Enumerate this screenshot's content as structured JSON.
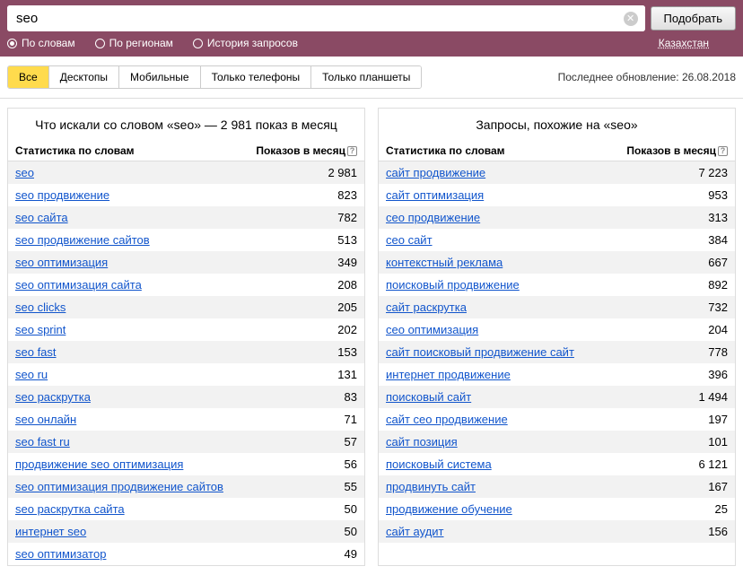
{
  "search": {
    "value": "seo",
    "submit": "Подобрать"
  },
  "filters": {
    "by_words": "По словам",
    "by_regions": "По регионам",
    "history": "История запросов",
    "region": "Казахстан"
  },
  "tabs": {
    "all": "Все",
    "desktops": "Десктопы",
    "mobile": "Мобильные",
    "phones": "Только телефоны",
    "tablets": "Только планшеты"
  },
  "update_text": "Последнее обновление: 26.08.2018",
  "left": {
    "title": "Что искали со словом «seo» — 2 981 показ в месяц",
    "col_word": "Статистика по словам",
    "col_count": "Показов в месяц",
    "rows": [
      {
        "w": "seo",
        "c": "2 981"
      },
      {
        "w": "seo продвижение",
        "c": "823"
      },
      {
        "w": "seo сайта",
        "c": "782"
      },
      {
        "w": "seo продвижение сайтов",
        "c": "513"
      },
      {
        "w": "seo оптимизация",
        "c": "349"
      },
      {
        "w": "seo оптимизация сайта",
        "c": "208"
      },
      {
        "w": "seo clicks",
        "c": "205"
      },
      {
        "w": "seo sprint",
        "c": "202"
      },
      {
        "w": "seo fast",
        "c": "153"
      },
      {
        "w": "seo ru",
        "c": "131"
      },
      {
        "w": "seo раскрутка",
        "c": "83"
      },
      {
        "w": "seo онлайн",
        "c": "71"
      },
      {
        "w": "seo fast ru",
        "c": "57"
      },
      {
        "w": "продвижение seo оптимизация",
        "c": "56"
      },
      {
        "w": "seo оптимизация продвижение сайтов",
        "c": "55"
      },
      {
        "w": "seo раскрутка сайта",
        "c": "50"
      },
      {
        "w": "интернет seo",
        "c": "50"
      },
      {
        "w": "seo оптимизатор",
        "c": "49"
      }
    ]
  },
  "right": {
    "title": "Запросы, похожие на «seo»",
    "col_word": "Статистика по словам",
    "col_count": "Показов в месяц",
    "rows": [
      {
        "w": "сайт продвижение",
        "c": "7 223"
      },
      {
        "w": "сайт оптимизация",
        "c": "953"
      },
      {
        "w": "сео продвижение",
        "c": "313"
      },
      {
        "w": "сео сайт",
        "c": "384"
      },
      {
        "w": "контекстный реклама",
        "c": "667"
      },
      {
        "w": "поисковый продвижение",
        "c": "892"
      },
      {
        "w": "сайт раскрутка",
        "c": "732"
      },
      {
        "w": "сео оптимизация",
        "c": "204"
      },
      {
        "w": "сайт поисковый продвижение сайт",
        "c": "778"
      },
      {
        "w": "интернет продвижение",
        "c": "396"
      },
      {
        "w": "поисковый сайт",
        "c": "1 494"
      },
      {
        "w": "сайт сео продвижение",
        "c": "197"
      },
      {
        "w": "сайт позиция",
        "c": "101"
      },
      {
        "w": "поисковый система",
        "c": "6 121"
      },
      {
        "w": "продвинуть сайт",
        "c": "167"
      },
      {
        "w": "продвижение обучение",
        "c": "25"
      },
      {
        "w": "сайт аудит",
        "c": "156"
      }
    ]
  }
}
